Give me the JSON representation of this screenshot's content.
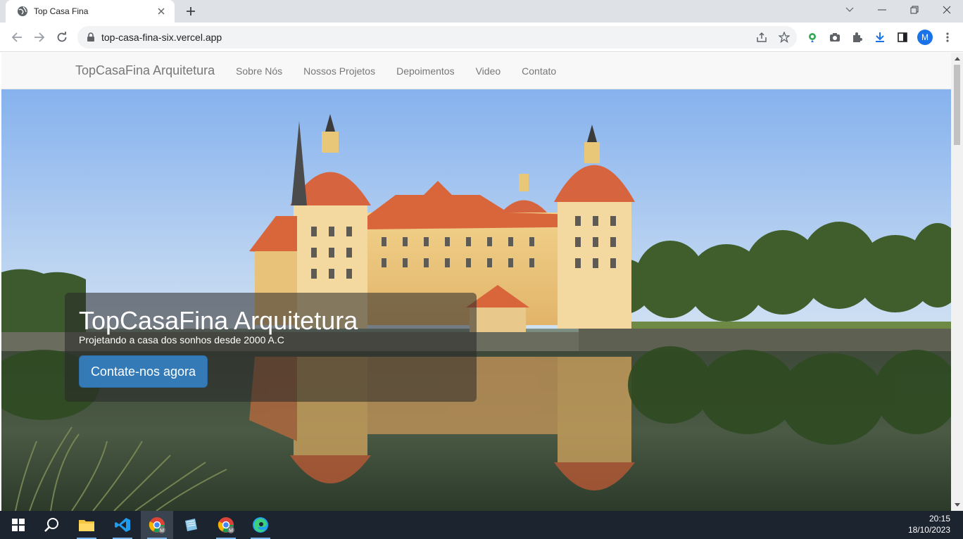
{
  "browser": {
    "tab_title": "Top Casa Fina",
    "url": "top-casa-fina-six.vercel.app",
    "profile_initial": "M",
    "accent": "#1a73e8"
  },
  "navbar": {
    "brand": "TopCasaFina Arquitetura",
    "links": [
      "Sobre Nós",
      "Nossos Projetos",
      "Depoimentos",
      "Video",
      "Contato"
    ]
  },
  "hero": {
    "title": "TopCasaFina Arquitetura",
    "subtitle": "Projetando a casa dos sonhos desde 2000 A.C",
    "cta_label": "Contate-nos agora",
    "cta_color": "#337ab7"
  },
  "taskbar": {
    "apps": [
      "windows-start",
      "search",
      "file-explorer",
      "vscode",
      "chrome",
      "notepad",
      "chrome",
      "edge"
    ],
    "time": "20:15",
    "date": "18/10/2023"
  }
}
